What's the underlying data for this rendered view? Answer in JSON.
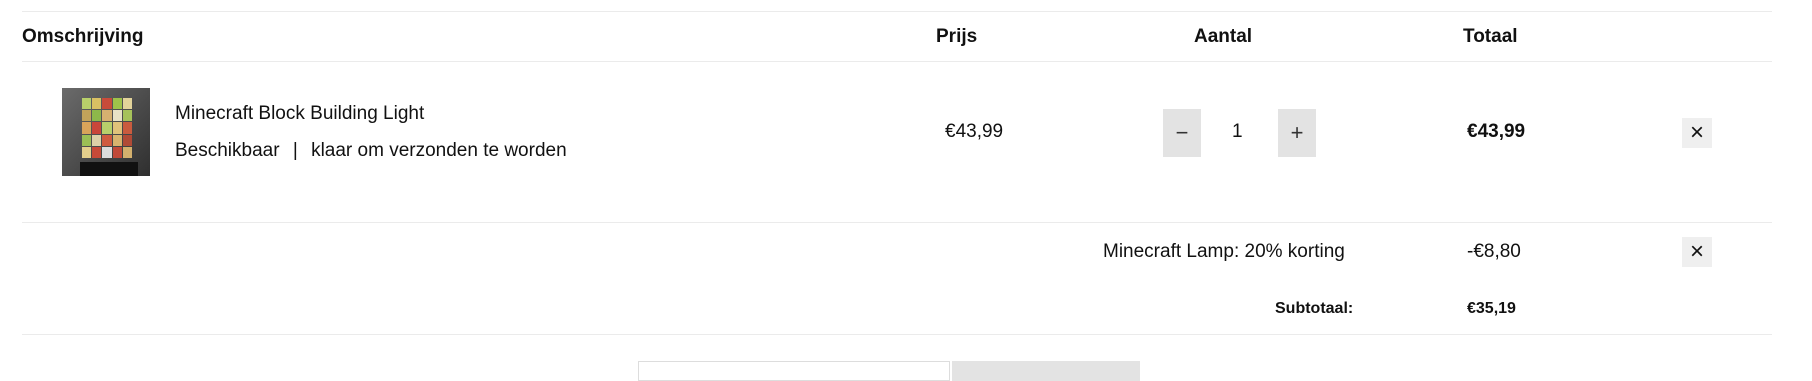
{
  "table": {
    "headers": {
      "description": "Omschrijving",
      "price": "Prijs",
      "quantity": "Aantal",
      "total": "Totaal"
    }
  },
  "item": {
    "name": "Minecraft Block Building Light",
    "availability": "Beschikbaar",
    "separator": "|",
    "shipping_status": "klaar om verzonden te worden",
    "price": "€43,99",
    "quantity": "1",
    "decrement_symbol": "−",
    "increment_symbol": "+",
    "total": "€43,99",
    "remove_symbol": "×",
    "thumbnail_icon": "minecraft-lamp-product-image"
  },
  "discount": {
    "label": "Minecraft Lamp: 20% korting",
    "amount": "-€8,80",
    "remove_symbol": "×"
  },
  "subtotal": {
    "label": "Subtotaal:",
    "amount": "€35,19"
  }
}
